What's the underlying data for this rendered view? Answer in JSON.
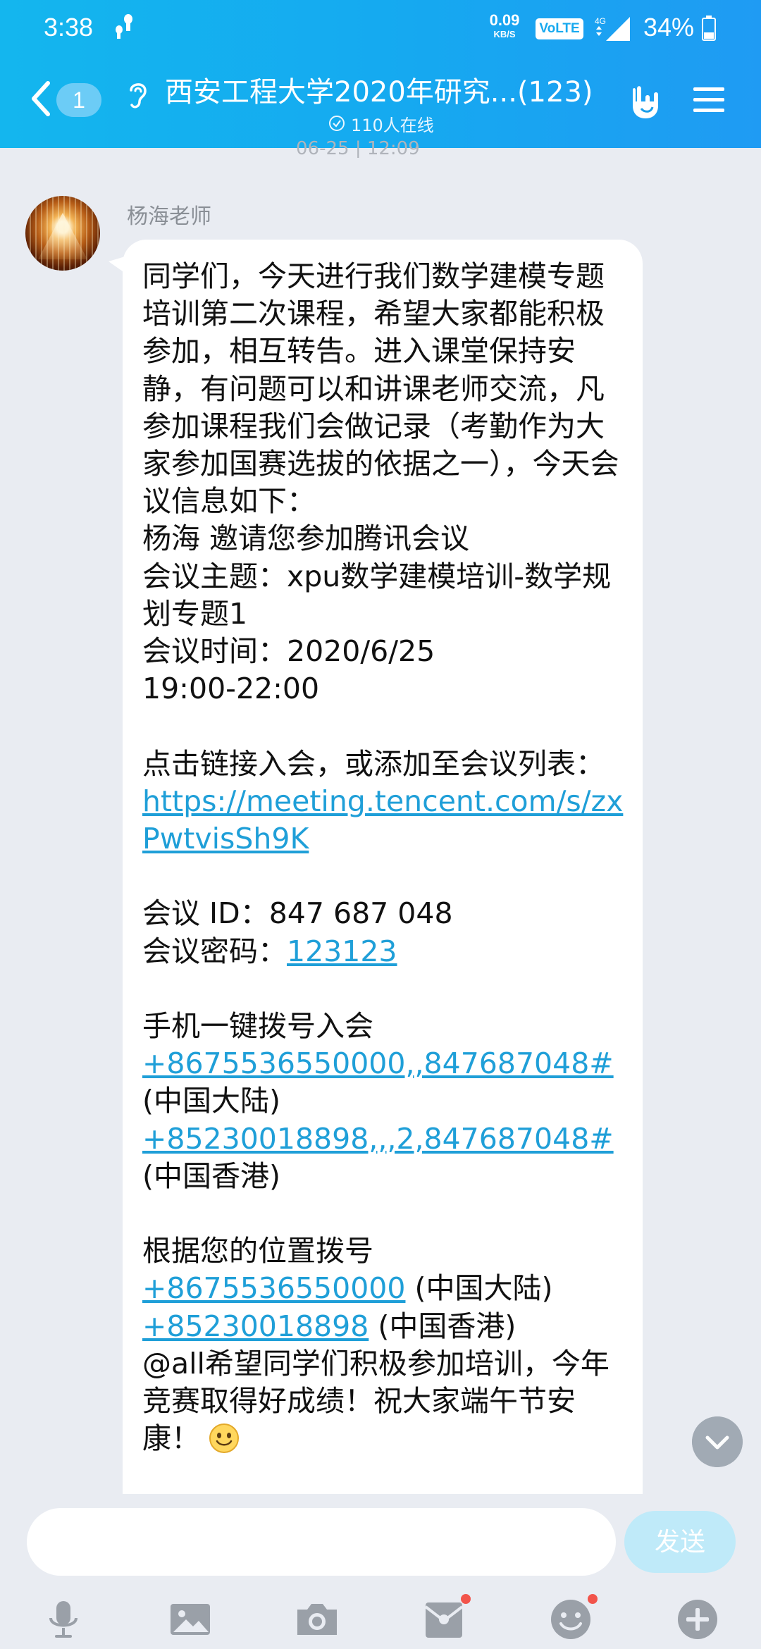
{
  "status_bar": {
    "time": "3:38",
    "net_speed_value": "0.09",
    "net_speed_unit": "KB/S",
    "volte": "VoLTE",
    "network": "4G",
    "battery": "34%"
  },
  "header": {
    "unread_count": "1",
    "title": "西安工程大学2020年研究...(123)",
    "online": "110人在线"
  },
  "chat": {
    "partial_timestamp": "06-25  |  12:09",
    "sender": "杨海老师",
    "message": {
      "intro": "同学们，今天进行我们数学建模专题培训第二次课程，希望大家都能积极参加，相互转告。进入课堂保持安静，有问题可以和讲课老师交流，凡参加课程我们会做记录（考勤作为大家参加国赛选拔的依据之一），今天会议信息如下：",
      "invite": "杨海 邀请您参加腾讯会议",
      "topic": "会议主题：xpu数学建模培训-数学规划专题1",
      "time_label": "会议时间：2020/6/25",
      "time_range": "19:00-22:00",
      "join_prompt": "点击链接入会，或添加至会议列表：",
      "link": "https://meeting.tencent.com/s/zxPwtvisSh9K",
      "meeting_id": "会议 ID：847 687 048",
      "password_label": "会议密码：",
      "password": "123123",
      "one_tap_title": "手机一键拨号入会",
      "one_tap_mainland": "+8675536550000,,847687048#",
      "mainland_label": "(中国大陆)",
      "one_tap_hk": "+85230018898,,,2,847687048#",
      "hk_label": "(中国香港)",
      "dial_title": "根据您的位置拨号",
      "dial_mainland": "+8675536550000",
      "dial_mainland_label": " (中国大陆)",
      "dial_hk": "+85230018898",
      "dial_hk_label": " (中国香港)",
      "closing": "@all希望同学们积极参加培训，今年竞赛取得好成绩！祝大家端午节安康！"
    }
  },
  "input": {
    "placeholder": "",
    "send_label": "发送"
  },
  "toolbar": {
    "icons": [
      "microphone-icon",
      "image-icon",
      "camera-icon",
      "red-packet-icon",
      "emoji-icon",
      "plus-icon"
    ]
  },
  "colors": {
    "header": "#15aaf0",
    "link": "#1f9fd8",
    "send_button": "#bfeaf9",
    "badge": "#6cccf6",
    "notification_dot": "#f2544b"
  }
}
